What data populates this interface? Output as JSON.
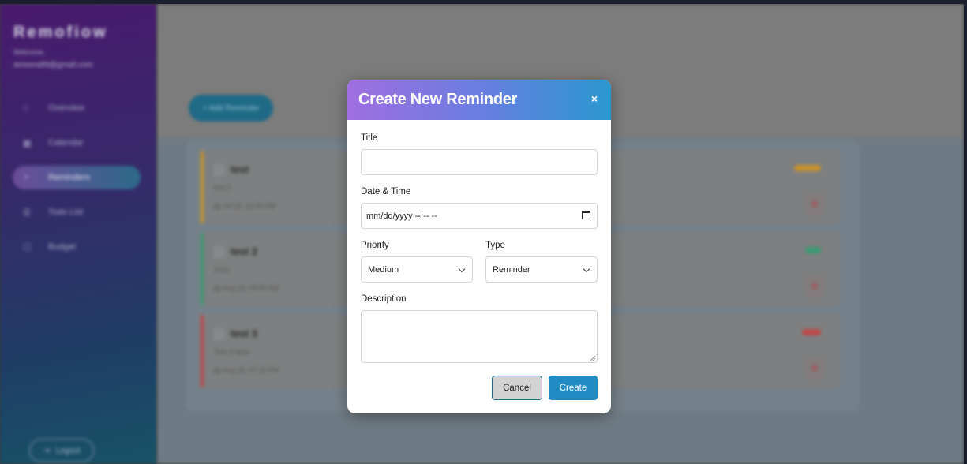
{
  "sidebar": {
    "brand": "Remofiow",
    "welcome": "Welcome,",
    "email": "ameera99@gmail.com",
    "items": [
      {
        "icon": "⌂",
        "label": "Overview"
      },
      {
        "icon": "▦",
        "label": "Calendar"
      },
      {
        "icon": "◔",
        "label": "Reminders"
      },
      {
        "icon": "☰",
        "label": "Todo List"
      },
      {
        "icon": "☐",
        "label": "Budget"
      }
    ],
    "logout": "Logout",
    "logout_icon": "⇥"
  },
  "main": {
    "add_button": "+ Add Reminder",
    "reminders": [
      {
        "title": "test",
        "description": "test 1",
        "date": "▤ Jul 15, 10:30 AM",
        "priority": "medium",
        "color": "#c8922a"
      },
      {
        "title": "test 2",
        "description": "2222",
        "date": "▤ Aug 13, 08:00 AM",
        "priority": "low",
        "color": "#3a9a72"
      },
      {
        "title": "test 3",
        "description": "Test 3 desc",
        "date": "▤ Aug 22, 07:15 PM",
        "priority": "high",
        "color": "#c04848"
      }
    ],
    "delete_icon": "🗑"
  },
  "modal": {
    "title": "Create New Reminder",
    "close": "×",
    "title_label": "Title",
    "title_value": "",
    "datetime_label": "Date & Time",
    "datetime_placeholder": "mm/dd/yyyy --:-- --",
    "priority_label": "Priority",
    "priority_value": "Medium",
    "type_label": "Type",
    "type_value": "Reminder",
    "description_label": "Description",
    "description_value": "",
    "cancel": "Cancel",
    "create": "Create",
    "colors": {
      "header_start": "#a06ee0",
      "header_end": "#2a98d0",
      "create_button": "#218cc4"
    }
  }
}
